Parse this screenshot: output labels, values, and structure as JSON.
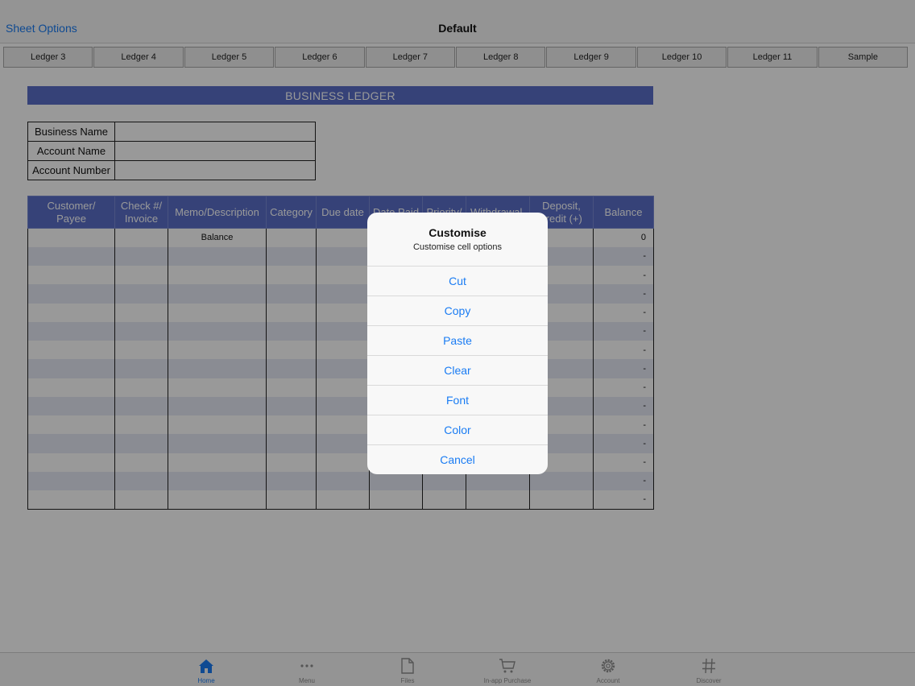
{
  "navbar": {
    "left_label": "Sheet Options",
    "title": "Default"
  },
  "tabs": [
    "Ledger 3",
    "Ledger 4",
    "Ledger 5",
    "Ledger 6",
    "Ledger 7",
    "Ledger 8",
    "Ledger 9",
    "Ledger 10",
    "Ledger 11",
    "Sample"
  ],
  "ledger_title": "BUSINESS LEDGER",
  "info_fields": [
    "Business Name",
    "Account Name",
    "Account Number"
  ],
  "grid": {
    "headers": [
      [
        "Customer/",
        "Payee"
      ],
      [
        "Check #/",
        "Invoice"
      ],
      [
        "Memo/Description",
        ""
      ],
      [
        "Category",
        ""
      ],
      [
        "Due date",
        ""
      ],
      [
        "Date Paid",
        ""
      ],
      [
        "Priority/",
        ""
      ],
      [
        "Withdrawal,",
        ""
      ],
      [
        "Deposit,",
        "credit (+)"
      ],
      [
        "Balance",
        ""
      ]
    ],
    "first_row_memo": "Balance",
    "balances": [
      "0",
      "-",
      "-",
      "-",
      "-",
      "-",
      "-",
      "-",
      "-",
      "-",
      "-",
      "-",
      "-",
      "-",
      "-"
    ]
  },
  "tabbar": [
    {
      "label": "Home",
      "icon": "home-icon"
    },
    {
      "label": "Menu",
      "icon": "dots-icon"
    },
    {
      "label": "Files",
      "icon": "file-icon"
    },
    {
      "label": "In-app Purchase",
      "icon": "cart-icon"
    },
    {
      "label": "Account",
      "icon": "gear-icon"
    },
    {
      "label": "Discover",
      "icon": "hash-icon"
    }
  ],
  "dialog": {
    "title": "Customise",
    "message": "Customise cell options",
    "actions": [
      "Cut",
      "Copy",
      "Paste",
      "Clear",
      "Font",
      "Color",
      "Cancel"
    ]
  },
  "colors": {
    "accent": "#1a7cf3",
    "header_blue": "#5a6fc9",
    "row_alt": "#e6e9f6"
  }
}
